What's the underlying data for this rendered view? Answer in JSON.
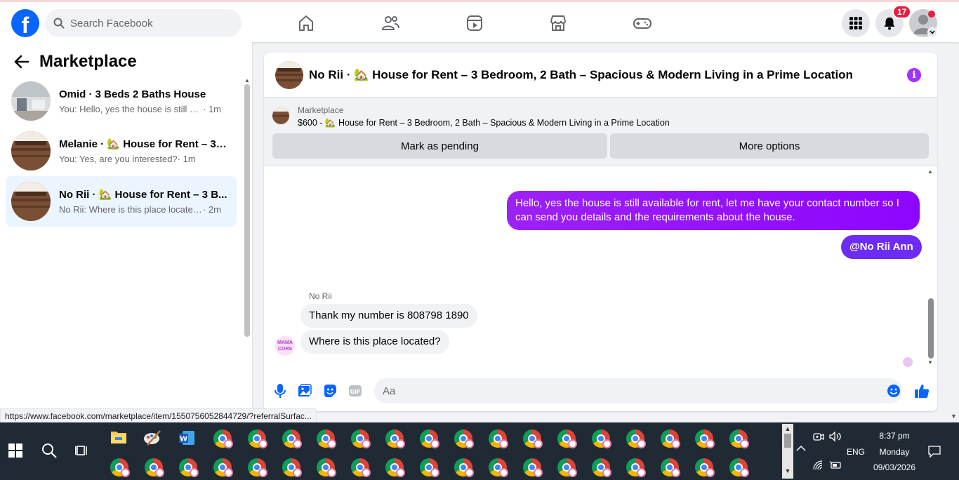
{
  "topbar": {
    "logo_letter": "f",
    "search_placeholder": "Search Facebook",
    "notification_count": "17"
  },
  "sidebar": {
    "title": "Marketplace",
    "conversations": [
      {
        "name": "Omid · 3 Beds 2 Baths House",
        "preview": "You: Hello, yes the house is still av...",
        "time": "· 1m",
        "active": false
      },
      {
        "name": "Melanie · 🏡 House for Rent – 3 ...",
        "preview": "You: Yes, are you interested?",
        "time": "· 1m",
        "active": false
      },
      {
        "name": "No Rii · 🏡 House for Rent – 3 B...",
        "preview": "No Rii: Where is this place located?",
        "time": "· 2m",
        "active": true
      }
    ]
  },
  "chat": {
    "title": "No Rii · 🏡 House for Rent – 3 Bedroom, 2 Bath – Spacious & Modern Living in a Prime Location",
    "marketplace_label": "Marketplace",
    "listing_line": "$600 - 🏡 House for Rent – 3 Bedroom, 2 Bath – Spacious & Modern Living in a Prime Location",
    "mark_pending_label": "Mark as pending",
    "more_options_label": "More options",
    "outgoing_message": "Hello, yes the house is still available for rent, let me have your contact number so I can send you details and the requirements about the house.",
    "mention": "@No Rii Ann",
    "sender_name": "No Rii",
    "incoming_messages": [
      "Thank my number is 808798 1890",
      "Where is this place located?"
    ],
    "avatar_text": "MAMA CORS",
    "composer_placeholder": "Aa"
  },
  "status_url": "https://www.facebook.com/marketplace/item/1550756052844729/?referralSurfac...",
  "taskbar": {
    "time": "8:37 pm",
    "day": "Monday",
    "date": "09/03/2026",
    "language": "ENG"
  },
  "colors": {
    "facebook_blue": "#0866ff",
    "message_purple": "#9d21f5",
    "mention_purple": "#6c2cf5",
    "badge_red": "#e41e3f",
    "active_conversation": "#ebf5ff"
  }
}
